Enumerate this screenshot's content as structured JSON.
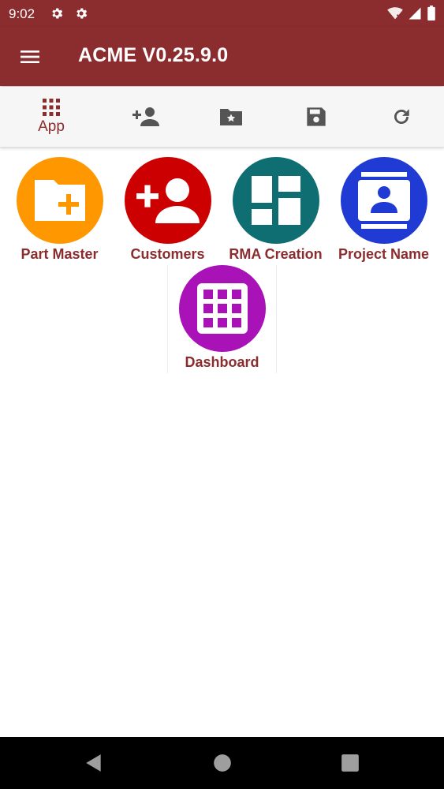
{
  "status_bar": {
    "time": "9:02"
  },
  "app_bar": {
    "title": "ACME V0.25.9.0"
  },
  "toolbar": {
    "items": [
      {
        "label": "App",
        "icon": "grid-icon"
      },
      {
        "label": "",
        "icon": "add-person-icon"
      },
      {
        "label": "",
        "icon": "folder-star-icon"
      },
      {
        "label": "",
        "icon": "save-icon"
      },
      {
        "label": "",
        "icon": "refresh-icon"
      }
    ]
  },
  "tiles": [
    {
      "label": "Part Master",
      "color": "#ff9800",
      "icon": "folder-add-icon"
    },
    {
      "label": "Customers",
      "color": "#cc0000",
      "icon": "add-person-icon"
    },
    {
      "label": "RMA Creation",
      "color": "#0e6e72",
      "icon": "dashboard-layout-icon"
    },
    {
      "label": "Project Name",
      "color": "#1f3bd4",
      "icon": "contact-card-icon"
    },
    {
      "label": "Dashboard",
      "color": "#a812b7",
      "icon": "grid-icon"
    }
  ],
  "colors": {
    "brand": "#8b2c2e",
    "toolbar_bg": "#f6f6f6",
    "nav_bg": "#000000"
  }
}
